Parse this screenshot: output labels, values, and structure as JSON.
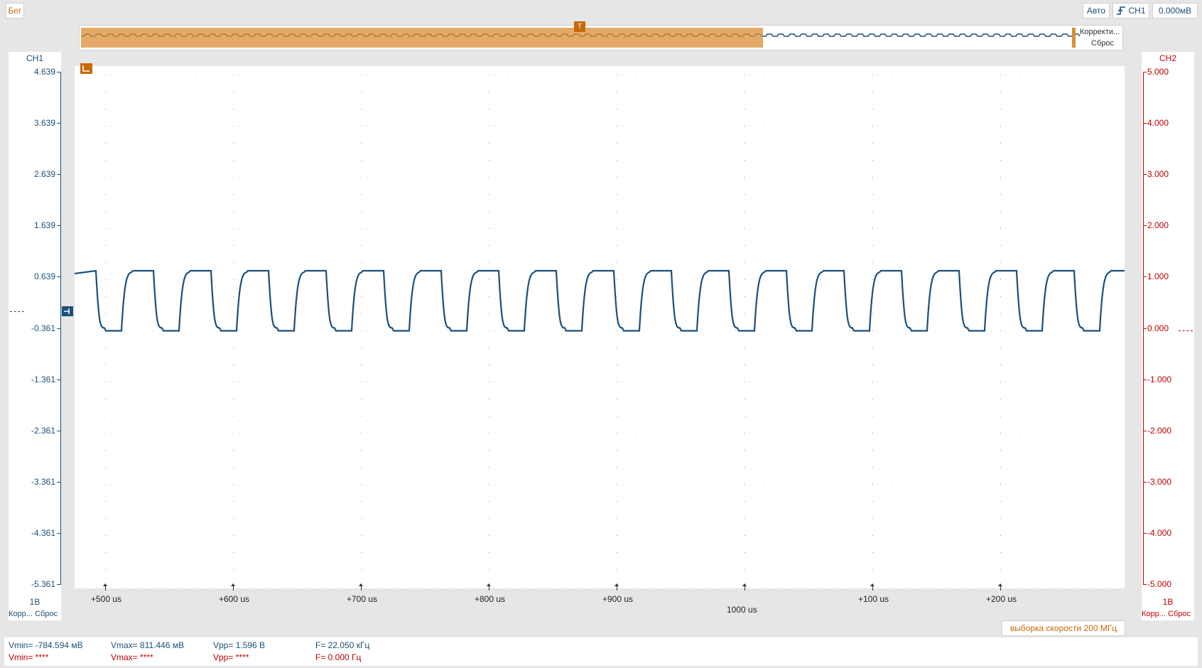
{
  "toolbar": {
    "run_label": "Бег",
    "mode_label": "Авто",
    "trigger_channel": "CH1",
    "trigger_level": "0.000мВ"
  },
  "overview": {
    "trigger_marker": "T",
    "adjust_label": "Корректи...",
    "reset_label": "Сброс"
  },
  "ch1": {
    "label": "CH1",
    "scale": "1В",
    "adjust_label": "Корр...",
    "reset_label": "Сброс",
    "color": "#1b4f7a",
    "ticks": [
      "4.639",
      "3.639",
      "2.639",
      "1.639",
      "0.639",
      "-0.361",
      "-1.361",
      "-2.361",
      "-3.361",
      "-4.361",
      "-5.361"
    ]
  },
  "ch2": {
    "label": "CH2",
    "scale": "1В",
    "adjust_label": "Корр...",
    "reset_label": "Сброс",
    "color": "#c00000",
    "ticks": [
      "5.000",
      "4.000",
      "3.000",
      "2.000",
      "1.000",
      "0.000",
      "-1.000",
      "-2.000",
      "-3.000",
      "-4.000",
      "-5.000"
    ]
  },
  "xaxis": {
    "ticks": [
      "+500 us",
      "+600 us",
      "+700 us",
      "+800 us",
      "+900 us",
      "",
      "+100 us",
      "+200 us"
    ],
    "center_label": "1000 us"
  },
  "sample_rate": "выборка скорости 200 МГц",
  "measurements": {
    "ch1": {
      "vmin": "Vmin= -784.594 мВ",
      "vmax": "Vmax= 811.446 мВ",
      "vpp": "Vpp= 1.596 В",
      "freq": "F= 22.050 кГц"
    },
    "ch2": {
      "vmin": "Vmin= ****",
      "vmax": "Vmax= ****",
      "vpp": "Vpp= ****",
      "freq": "F= 0.000 Гц"
    }
  },
  "chart_data": {
    "type": "line",
    "series": [
      {
        "name": "CH1",
        "color": "#1b4f7a",
        "low": -0.361,
        "high": 0.811,
        "low_shown": -0.78,
        "frequency_khz": 22.05
      }
    ],
    "ylim": [
      -5.361,
      4.639
    ],
    "y2lim": [
      -5.0,
      5.0
    ]
  }
}
